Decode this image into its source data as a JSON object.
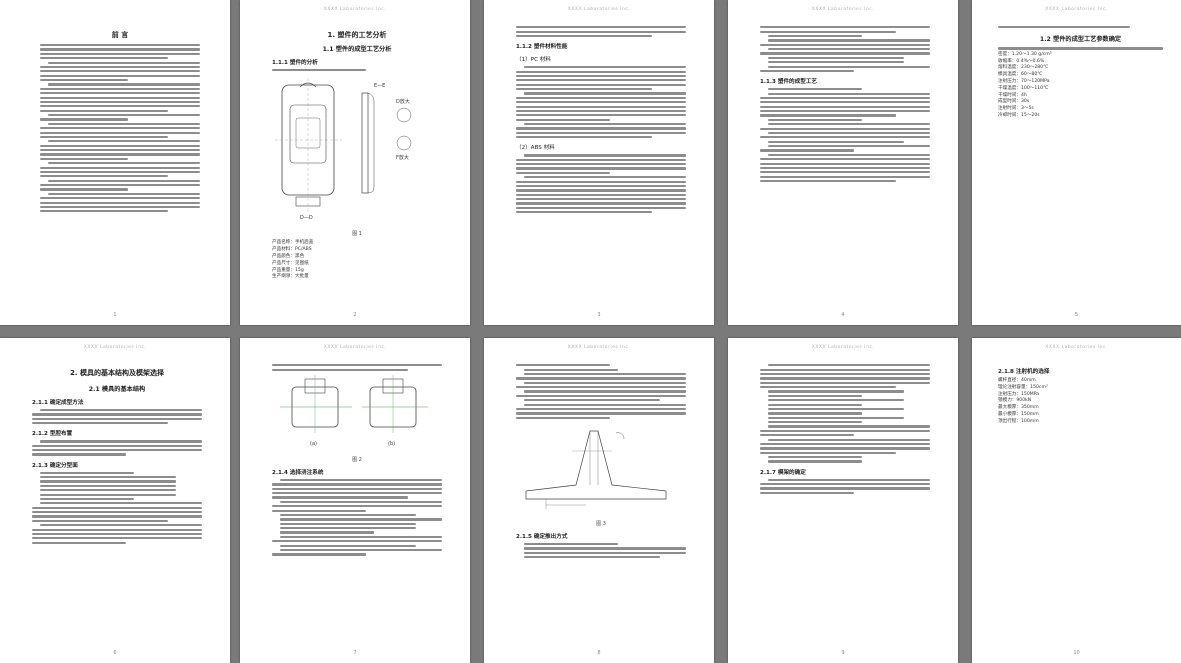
{
  "header_text": "XXXX Laboratories Inc.",
  "page1": {
    "title": "前 言",
    "number": "1"
  },
  "page2": {
    "chapter": "1. 塑件的工艺分析",
    "section": "1.1 塑件的成型工艺分析",
    "sub": "1.1.1 塑件的分析",
    "fig_caption": "图 1",
    "view_labels": [
      "E—E",
      "D放大",
      "F放大",
      "D—D"
    ],
    "specs": [
      "产品名称：手机后盖",
      "产品材料：PC/ABS",
      "产品颜色：黑色",
      "产品尺寸：见图纸",
      "产品重量：15g",
      "生产纲领：大批量"
    ],
    "number": "2"
  },
  "page3": {
    "sub1": "1.1.2 塑件材料性能",
    "sub2": "（1）PC 材料",
    "sub3": "（2）ABS 材料",
    "number": "3"
  },
  "page4": {
    "sub": "1.1.3 塑件的成型工艺",
    "number": "4"
  },
  "page5": {
    "section": "1.2 塑件的成型工艺参数确定",
    "params": [
      "密度：1.20～1.30 g/cm³",
      "收缩率：0.4%～0.6%",
      "熔料温度：230～280℃",
      "模具温度：60～80℃",
      "注射压力：70～120MPa",
      "干燥温度：100～110℃",
      "干燥时间：4h",
      "成型时间：30s",
      "注射时间：3～5s",
      "冷却时间：15～20s"
    ],
    "number": "5"
  },
  "page6": {
    "chapter": "2. 模具的基本结构及模架选择",
    "section": "2.1 模具的基本结构",
    "sub1": "2.1.1 确定成型方法",
    "sub2": "2.1.2 型腔布置",
    "sub3": "2.1.3 确定分型面",
    "number": "6"
  },
  "page7": {
    "captions": [
      "(a)",
      "(b)"
    ],
    "fig_caption": "图 2",
    "sub": "2.1.4 选择浇注系统",
    "number": "7"
  },
  "page8": {
    "sub1": "2.1.5 确定推出方式",
    "fig_caption": "图 3",
    "sub2": "2.1.6 确定侧抽芯方式",
    "number": "8"
  },
  "page9": {
    "sub": "2.1.7 模架的确定",
    "number": "9"
  },
  "page10": {
    "sub": "2.1.8 注射机的选择",
    "specs": [
      "螺杆直径：40mm",
      "理论注射容量：150cm³",
      "注射压力：150MPa",
      "锁模力：900kN",
      "最大模厚：350mm",
      "最小模厚：150mm",
      "顶出行程：100mm"
    ],
    "number": "10"
  },
  "colors": {
    "page_bg": "#ffffff",
    "desk_bg": "#7a7a7a",
    "text_line": "#8d8d8d"
  }
}
